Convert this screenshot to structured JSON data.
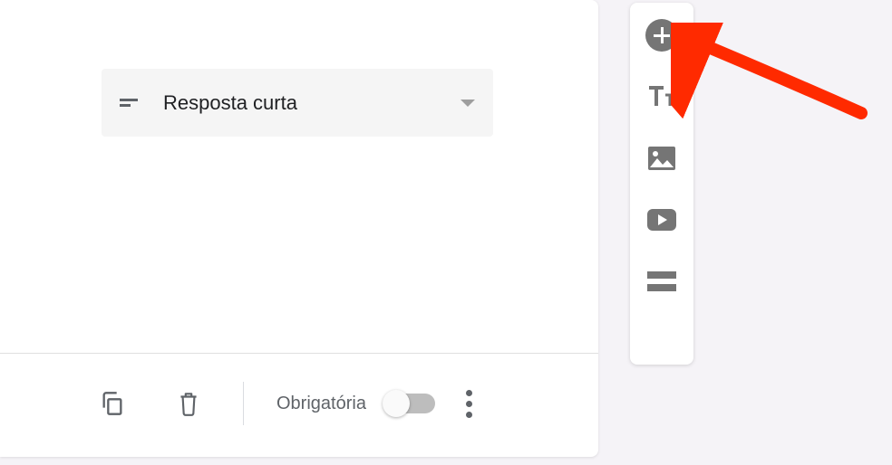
{
  "questionType": {
    "selected": "Resposta curta"
  },
  "footer": {
    "requiredLabel": "Obrigatória"
  },
  "toolbar": {
    "items": [
      "add-question",
      "add-title",
      "add-image",
      "add-video",
      "add-section"
    ]
  },
  "annotation": {
    "target": "add-question-button",
    "color": "#ff2a00"
  }
}
